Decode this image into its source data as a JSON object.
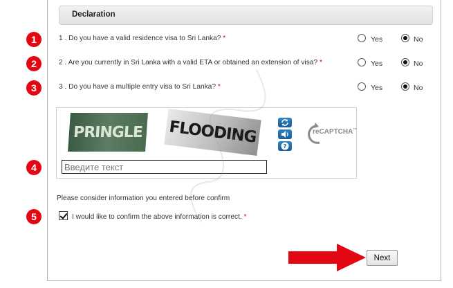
{
  "section": {
    "title": "Declaration"
  },
  "questions": [
    {
      "number": "1",
      "text": "1 . Do you have a valid residence visa to Sri Lanka?",
      "required": "*",
      "selected": "No"
    },
    {
      "number": "2",
      "text": "2 . Are you currently in Sri Lanka with a valid ETA or obtained an extension of visa?",
      "required": "*",
      "selected": "No"
    },
    {
      "number": "3",
      "text": "3 . Do you have a multiple entry visa to Sri Lanka?",
      "required": "*",
      "selected": "No"
    }
  ],
  "options": {
    "yes": "Yes",
    "no": "No"
  },
  "captcha": {
    "word1": "PRINGLE",
    "word2": "FLOODING",
    "brand": "reCAPTCHA",
    "brand_tm": "™",
    "input_placeholder": "Введите текст",
    "badge": "4",
    "refresh_icon": "refresh-icon",
    "audio_icon": "audio-icon",
    "help_icon": "help-icon"
  },
  "info": "Please consider information you entered before confirm",
  "confirm": {
    "badge": "5",
    "label": "I would like to confirm the above information is correct.",
    "required": "*",
    "checked": true
  },
  "next_label": "Next",
  "colors": {
    "badge": "#e30613",
    "arrow": "#e30613",
    "recaptcha_button": "#1f6fae"
  }
}
